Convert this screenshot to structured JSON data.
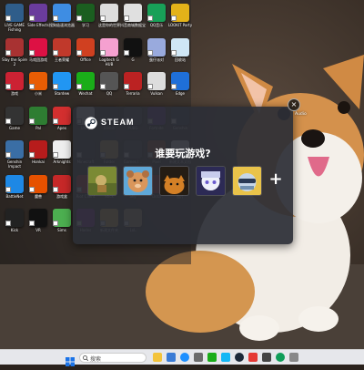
{
  "desktop": {
    "icons": [
      {
        "label": "LIVE GAME Fishing",
        "color": "#2f5d8a"
      },
      {
        "label": "Side Effects",
        "color": "#6a3c9c"
      },
      {
        "label": "搜狗极速浏览器",
        "color": "#3e8de3"
      },
      {
        "label": "学习",
        "color": "#1b5e20"
      },
      {
        "label": "这是你的世界",
        "color": "#ddd"
      },
      {
        "label": "抖音商城数据宝",
        "color": "#e0e0e0"
      },
      {
        "label": "QQ音乐",
        "color": "#18a058"
      },
      {
        "label": "LOOKIT Party",
        "color": "#e3b219"
      },
      {
        "label": "Slay the Spire 2",
        "color": "#a83232"
      },
      {
        "label": "马戏团游戏",
        "color": "#d14"
      },
      {
        "label": "王者荣耀",
        "color": "#c0392b"
      },
      {
        "label": "Office",
        "color": "#d04020"
      },
      {
        "label": "Logitech G HUB",
        "color": "#f5a0d0"
      },
      {
        "label": "G",
        "color": "#111"
      },
      {
        "label": "蛋仔派对",
        "color": "#9ad"
      },
      {
        "label": "回收站",
        "color": "#cfe6f5"
      },
      {
        "label": "游戏",
        "color": "#c23"
      },
      {
        "label": "小米",
        "color": "#e85d04"
      },
      {
        "label": "Stardew",
        "color": "#2196f3"
      },
      {
        "label": "Wechat",
        "color": "#1aad19"
      },
      {
        "label": "QQ",
        "color": "#555"
      },
      {
        "label": "Terraria",
        "color": "#bb2222"
      },
      {
        "label": "Vulkan",
        "color": "#ddd"
      },
      {
        "label": "Edge",
        "color": "#1f6fd8"
      },
      {
        "label": "Game",
        "color": "#333"
      },
      {
        "label": "Pal",
        "color": "#2e7d32"
      },
      {
        "label": "Apex",
        "color": "#d32f2f"
      },
      {
        "label": "Unity",
        "color": "#f0f0f0"
      },
      {
        "label": "Bilibili",
        "color": "#333"
      },
      {
        "label": "PUBG",
        "color": "#444"
      },
      {
        "label": "Fortnite",
        "color": "#663399"
      },
      {
        "label": "Genshin",
        "color": "#2c3e50"
      },
      {
        "label": "Genshin Impact",
        "color": "#3a6ea5"
      },
      {
        "label": "Honkai",
        "color": "#b71c1c"
      },
      {
        "label": "Arknights",
        "color": "#eee"
      },
      {
        "label": "Minecraft",
        "color": "#333"
      },
      {
        "label": "Folder",
        "color": "#d9b25a"
      },
      {
        "label": "Games I...",
        "color": "#444"
      },
      {
        "label": "Pixel",
        "color": "#aa4422"
      },
      {
        "label": "新建文本文档",
        "color": "#ffffff"
      },
      {
        "label": "BattleNet",
        "color": "#1e88e5"
      },
      {
        "label": "魔兽",
        "color": "#e65100"
      },
      {
        "label": "游戏盒",
        "color": "#c62828"
      },
      {
        "label": "Riot Client",
        "color": "#d32f2f"
      },
      {
        "label": "Stick",
        "color": "#333"
      },
      {
        "label": "Sky",
        "color": "#5d4037"
      },
      {
        "label": "Dota",
        "color": "#b71c1c"
      },
      {
        "label": "图片",
        "color": "#f0c040"
      },
      {
        "label": "Kick",
        "color": "#222"
      },
      {
        "label": "VR",
        "color": "#111"
      },
      {
        "label": "Sims",
        "color": "#4caf50"
      },
      {
        "label": "Hades",
        "color": "#8e24aa"
      },
      {
        "label": "新建文件夹",
        "color": "#f5c84c"
      },
      {
        "label": "LoL",
        "color": "#c9aa71"
      }
    ]
  },
  "steam": {
    "brand": "STEAM",
    "title": "谁要玩游戏?",
    "add_label": "+",
    "avatars": [
      {
        "name": "avatar-1",
        "bg": "#8a9a3a"
      },
      {
        "name": "avatar-2",
        "bg": "#d6955a"
      },
      {
        "name": "avatar-3",
        "bg": "#2b2117"
      },
      {
        "name": "avatar-4",
        "bg": "#cfd3e8"
      },
      {
        "name": "avatar-5",
        "bg": "#b8c9dc"
      }
    ]
  },
  "overlay_close": "×",
  "audio_label": "Audio",
  "taskbar": {
    "search_placeholder": "搜索"
  }
}
